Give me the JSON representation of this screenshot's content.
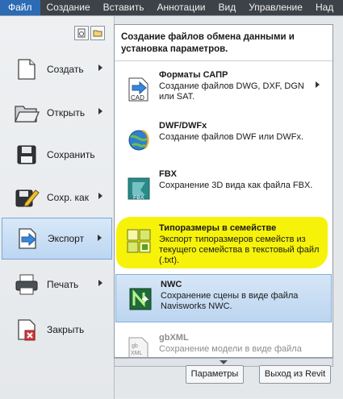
{
  "menubar": {
    "tabs": [
      "Файл",
      "Создание",
      "Вставить",
      "Аннотации",
      "Вид",
      "Управление",
      "Над"
    ]
  },
  "left_menu": {
    "items": [
      {
        "label": "Создать",
        "icon": "new-file-icon",
        "has_submenu": true
      },
      {
        "label": "Открыть",
        "icon": "open-folder-icon",
        "has_submenu": true
      },
      {
        "label": "Сохранить",
        "icon": "save-disk-icon",
        "has_submenu": false
      },
      {
        "label": "Сохр. как",
        "icon": "save-as-icon",
        "has_submenu": true
      },
      {
        "label": "Экспорт",
        "icon": "export-icon",
        "has_submenu": true,
        "active": true
      },
      {
        "label": "Печать",
        "icon": "printer-icon",
        "has_submenu": true
      },
      {
        "label": "Закрыть",
        "icon": "close-file-icon",
        "has_submenu": false
      }
    ]
  },
  "export_panel": {
    "header": "Создание файлов обмена данными и установка параметров.",
    "items": [
      {
        "title": "Форматы САПР",
        "desc": "Создание файлов DWG, DXF, DGN или SAT.",
        "icon": "cad-icon",
        "has_submenu": true
      },
      {
        "title": "DWF/DWFx",
        "desc": "Создание файлов DWF или DWFx.",
        "icon": "dwf-globe-icon"
      },
      {
        "title": "FBX",
        "desc": "Сохранение 3D вида как файла FBX.",
        "icon": "fbx-icon"
      },
      {
        "title": "Типоразмеры в семействе",
        "desc": "Экспорт типоразмеров семейств из текущего семейства в текстовый файл (.txt).",
        "icon": "family-types-icon"
      },
      {
        "title": "NWC",
        "desc": "Сохранение сцены в виде файла Navisworks NWC.",
        "icon": "navisworks-icon",
        "selected": true
      },
      {
        "title": "gbXML",
        "desc": "Сохранение модели в виде файла",
        "icon": "gbxml-icon",
        "dimmed": true
      }
    ]
  },
  "buttons": {
    "options": "Параметры",
    "exit": "Выход из Revit"
  },
  "colors": {
    "file_tab": "#2d6bb5",
    "menubar": "#3d4248",
    "highlight_yellow": "#f6f20a",
    "selection_blue": "#bcd5f0"
  }
}
